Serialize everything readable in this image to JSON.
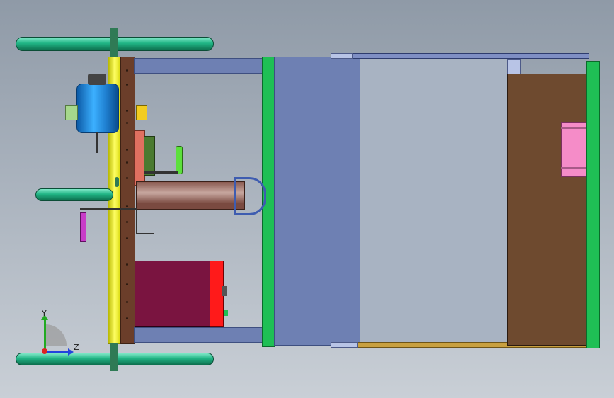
{
  "viewport": {
    "background_top": "#8f9aa7",
    "background_bottom": "#c9cfd6"
  },
  "triad": {
    "y_label": "Y",
    "z_label": "Z",
    "y_color": "#22aa22",
    "z_color": "#2244dd",
    "origin_color": "#dd2222"
  },
  "colors": {
    "wheel": "#20b585",
    "yellow_shaft": "#eaea2a",
    "brown_plate": "#6b3e2a",
    "blue_frame": "#6e80b3",
    "light_panel": "#a4b0c0",
    "green_bar": "#1fbf55",
    "motor_blue": "#2a8ee0",
    "gearbox_maroon": "#7a1440",
    "pink_block": "#f58cc8",
    "brown_panel": "#6e4a2f"
  }
}
